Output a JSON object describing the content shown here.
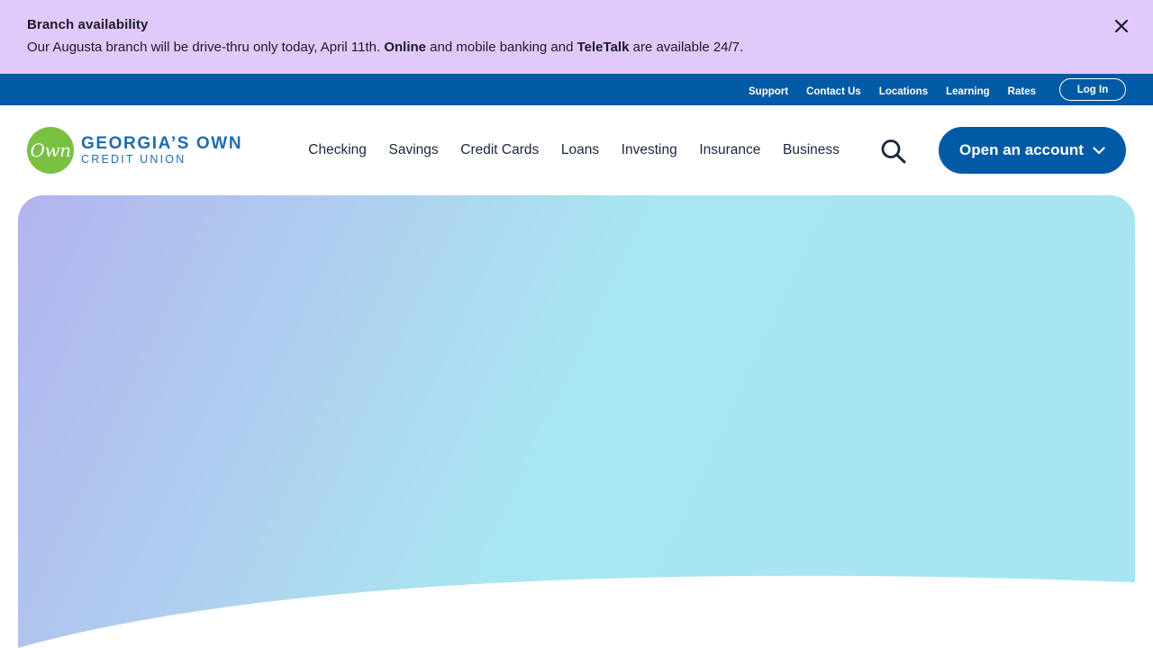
{
  "alert": {
    "title": "Branch availability",
    "message_part1": "Our Augusta branch will be drive-thru only today, April 11th. ",
    "message_bold1": "Online",
    "message_part2": " and mobile banking and ",
    "message_bold2": "TeleTalk",
    "message_part3": " are available 24/7.",
    "close_icon": "close-icon"
  },
  "utility": {
    "links": [
      "Support",
      "Contact Us",
      "Locations",
      "Learning",
      "Rates"
    ],
    "login_label": "Log In"
  },
  "header": {
    "logo": {
      "mark": "Own",
      "name": "GEORGIA’S OWN",
      "sub": "CREDIT UNION"
    },
    "nav": [
      "Checking",
      "Savings",
      "Credit Cards",
      "Loans",
      "Investing",
      "Insurance",
      "Business"
    ],
    "search_icon": "search-icon",
    "cta_label": "Open an account",
    "cta_icon": "chevron-down-icon"
  },
  "colors": {
    "alert_bg": "#e2c9fb",
    "brand_blue": "#005aa5",
    "logo_green": "#7ac143",
    "hero_gradient_start": "#b2b4ee",
    "hero_gradient_end": "#a6e6f1"
  }
}
